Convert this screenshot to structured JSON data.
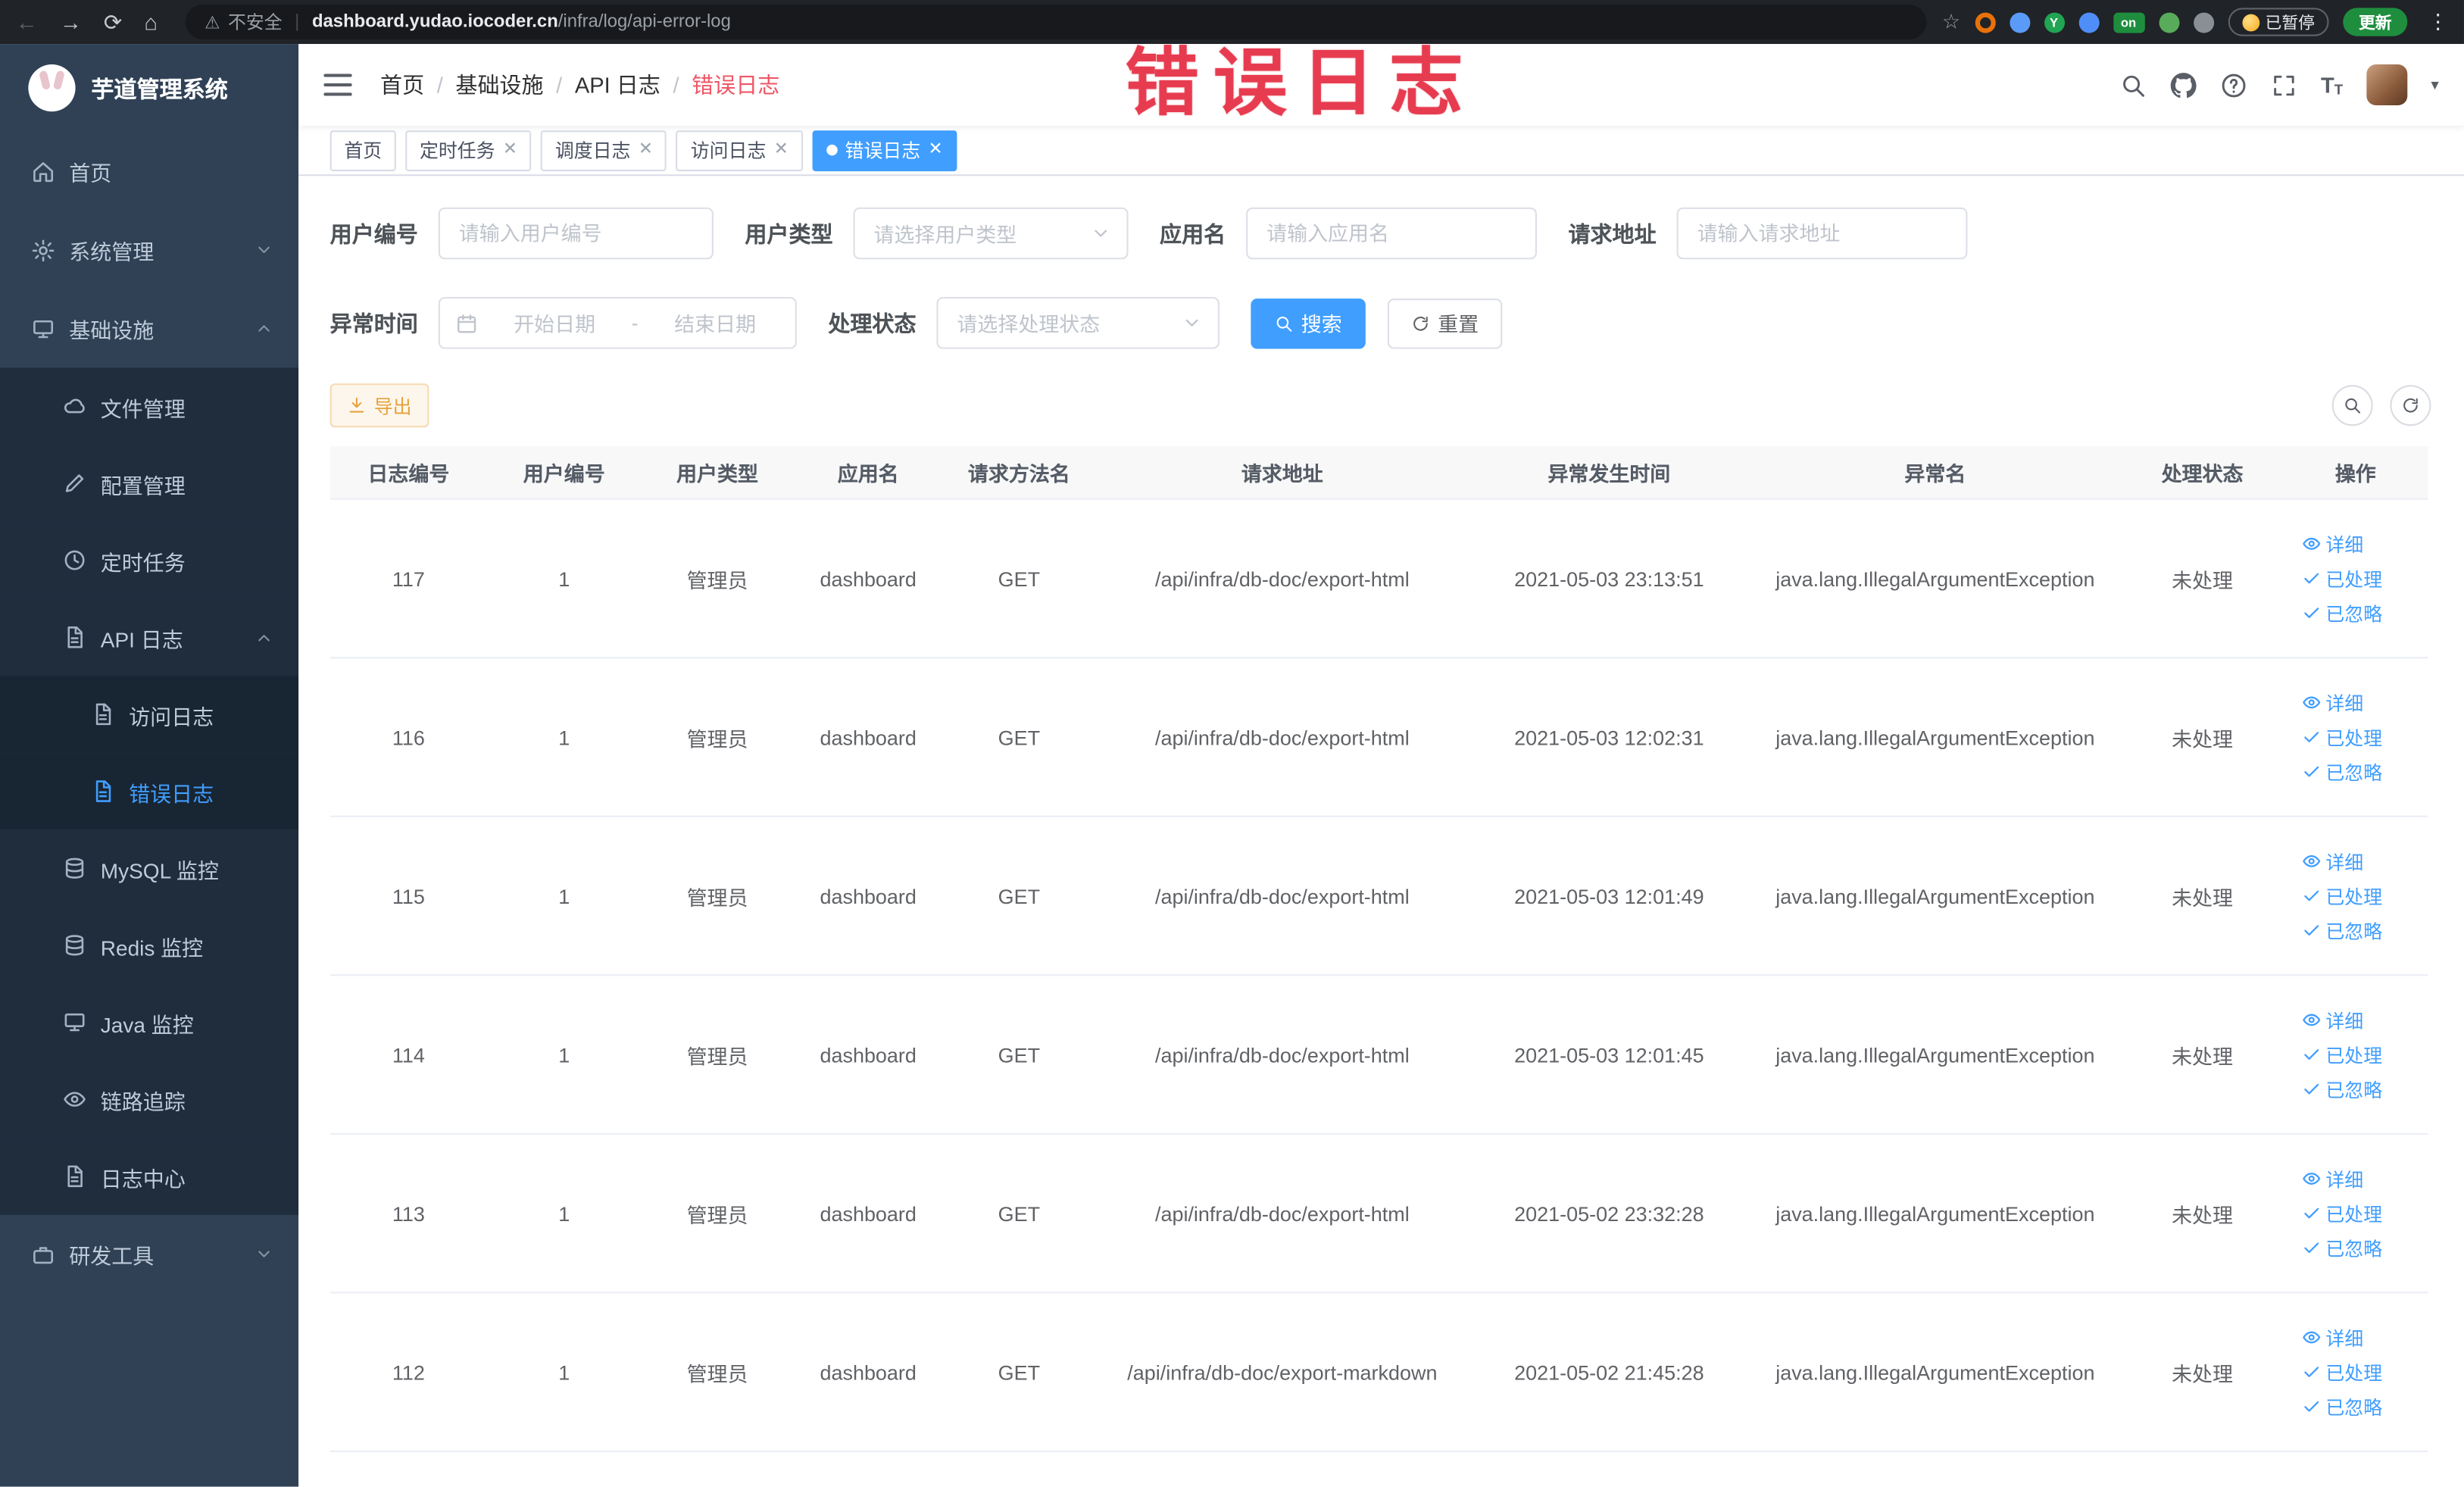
{
  "browser": {
    "security_label": "不安全",
    "url_host": "dashboard.yudao.iocoder.cn",
    "url_path": "/infra/log/api-error-log",
    "extension_on_label": "on",
    "paused_label": "已暂停",
    "update_label": "更新"
  },
  "annotation": {
    "text": "错误日志"
  },
  "sidebar": {
    "app_title": "芋道管理系统",
    "items": [
      {
        "label": "首页"
      },
      {
        "label": "系统管理"
      },
      {
        "label": "基础设施"
      },
      {
        "label": "文件管理"
      },
      {
        "label": "配置管理"
      },
      {
        "label": "定时任务"
      },
      {
        "label": "API 日志"
      },
      {
        "label": "访问日志"
      },
      {
        "label": "错误日志"
      },
      {
        "label": "MySQL 监控"
      },
      {
        "label": "Redis 监控"
      },
      {
        "label": "Java 监控"
      },
      {
        "label": "链路追踪"
      },
      {
        "label": "日志中心"
      },
      {
        "label": "研发工具"
      }
    ]
  },
  "header": {
    "breadcrumb_separator": "/",
    "breadcrumbs": [
      "首页",
      "基础设施",
      "API 日志",
      "错误日志"
    ]
  },
  "tabs": [
    {
      "label": "首页"
    },
    {
      "label": "定时任务"
    },
    {
      "label": "调度日志"
    },
    {
      "label": "访问日志"
    },
    {
      "label": "错误日志"
    }
  ],
  "filters": {
    "user_id": {
      "label": "用户编号",
      "placeholder": "请输入用户编号",
      "value": ""
    },
    "user_type": {
      "label": "用户类型",
      "placeholder": "请选择用户类型"
    },
    "app_name": {
      "label": "应用名",
      "placeholder": "请输入应用名",
      "value": ""
    },
    "request_url": {
      "label": "请求地址",
      "placeholder": "请输入请求地址",
      "value": ""
    },
    "exception_time": {
      "label": "异常时间",
      "start_placeholder": "开始日期",
      "separator": "-",
      "end_placeholder": "结束日期"
    },
    "process_status": {
      "label": "处理状态",
      "placeholder": "请选择处理状态"
    },
    "search_button": "搜索",
    "reset_button": "重置"
  },
  "toolbar": {
    "export_button": "导出"
  },
  "table": {
    "columns": [
      "日志编号",
      "用户编号",
      "用户类型",
      "应用名",
      "请求方法名",
      "请求地址",
      "异常发生时间",
      "异常名",
      "处理状态",
      "操作"
    ],
    "actions": [
      "详细",
      "已处理",
      "已忽略"
    ],
    "rows": [
      {
        "id": "117",
        "user_id": "1",
        "user_type": "管理员",
        "app": "dashboard",
        "method": "GET",
        "url": "/api/infra/db-doc/export-html",
        "time": "2021-05-03 23:13:51",
        "exception": "java.lang.IllegalArgumentException",
        "status": "未处理"
      },
      {
        "id": "116",
        "user_id": "1",
        "user_type": "管理员",
        "app": "dashboard",
        "method": "GET",
        "url": "/api/infra/db-doc/export-html",
        "time": "2021-05-03 12:02:31",
        "exception": "java.lang.IllegalArgumentException",
        "status": "未处理"
      },
      {
        "id": "115",
        "user_id": "1",
        "user_type": "管理员",
        "app": "dashboard",
        "method": "GET",
        "url": "/api/infra/db-doc/export-html",
        "time": "2021-05-03 12:01:49",
        "exception": "java.lang.IllegalArgumentException",
        "status": "未处理"
      },
      {
        "id": "114",
        "user_id": "1",
        "user_type": "管理员",
        "app": "dashboard",
        "method": "GET",
        "url": "/api/infra/db-doc/export-html",
        "time": "2021-05-03 12:01:45",
        "exception": "java.lang.IllegalArgumentException",
        "status": "未处理"
      },
      {
        "id": "113",
        "user_id": "1",
        "user_type": "管理员",
        "app": "dashboard",
        "method": "GET",
        "url": "/api/infra/db-doc/export-html",
        "time": "2021-05-02 23:32:28",
        "exception": "java.lang.IllegalArgumentException",
        "status": "未处理"
      },
      {
        "id": "112",
        "user_id": "1",
        "user_type": "管理员",
        "app": "dashboard",
        "method": "GET",
        "url": "/api/infra/db-doc/export-markdown",
        "time": "2021-05-02 21:45:28",
        "exception": "java.lang.IllegalArgumentException",
        "status": "未处理"
      }
    ]
  },
  "colors": {
    "accent": "#409EFF",
    "sidebar_bg": "#304156",
    "submenu_bg": "#1f2d3d",
    "warn_text": "#e6a23c",
    "annotation_red": "#e73c50"
  }
}
